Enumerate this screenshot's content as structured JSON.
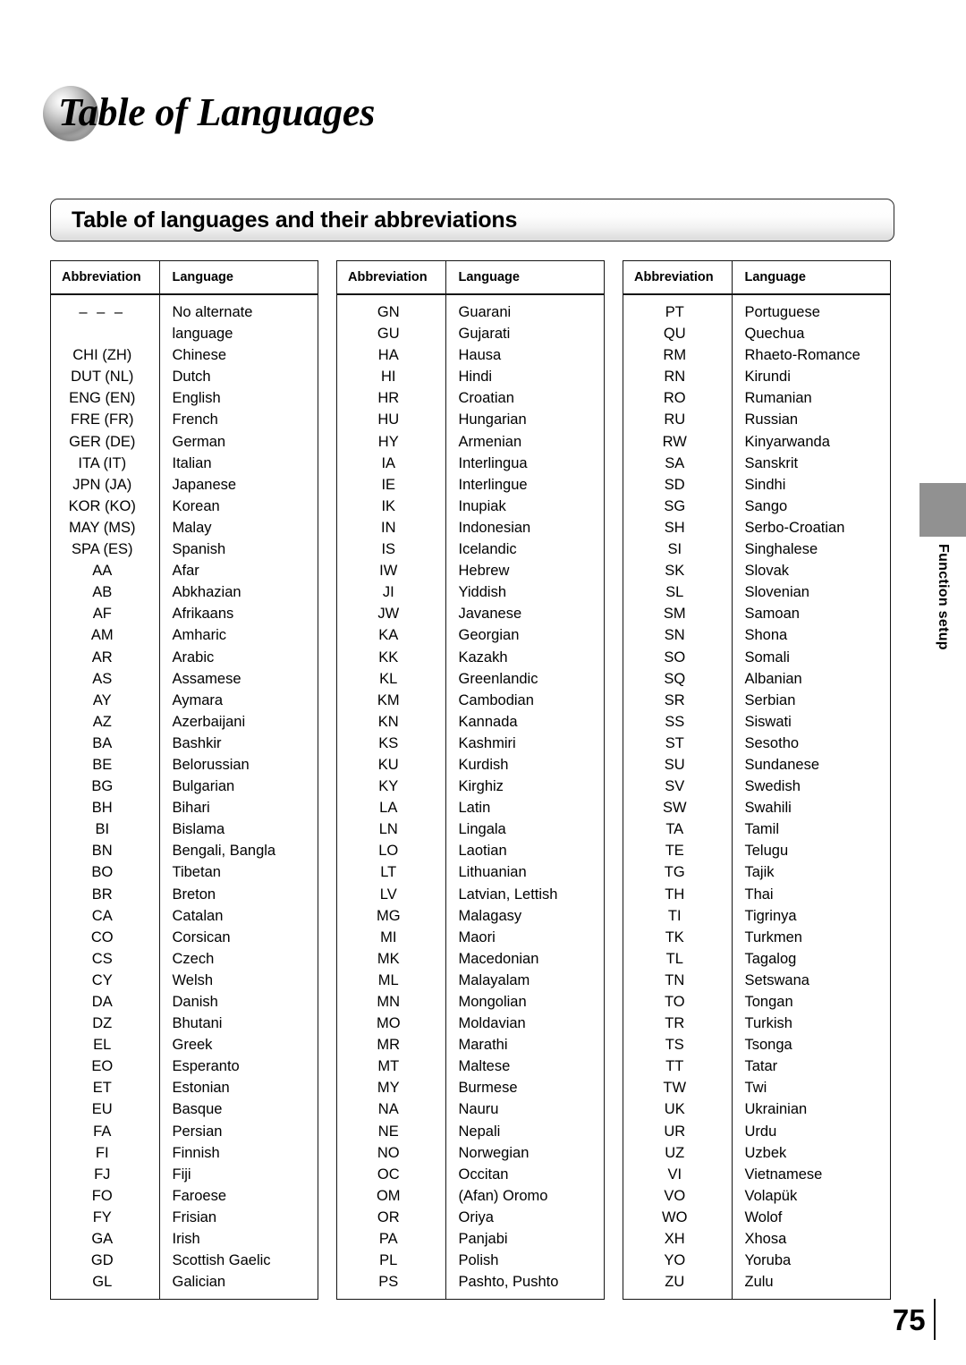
{
  "page": {
    "title": "Table of Languages",
    "section_heading": "Table of languages and their abbreviations",
    "number": "75",
    "side_tab_label": "Function setup"
  },
  "table_headers": {
    "abbreviation": "Abbreviation",
    "language": "Language"
  },
  "columns": [
    {
      "id": "column-1",
      "rows": [
        {
          "abbr": "– – –",
          "lang": "No alternate"
        },
        {
          "abbr": "",
          "lang": "language"
        },
        {
          "abbr": "CHI (ZH)",
          "lang": "Chinese"
        },
        {
          "abbr": "DUT (NL)",
          "lang": "Dutch"
        },
        {
          "abbr": "ENG (EN)",
          "lang": "English"
        },
        {
          "abbr": "FRE (FR)",
          "lang": "French"
        },
        {
          "abbr": "GER (DE)",
          "lang": "German"
        },
        {
          "abbr": "ITA (IT)",
          "lang": "Italian"
        },
        {
          "abbr": "JPN (JA)",
          "lang": "Japanese"
        },
        {
          "abbr": "KOR (KO)",
          "lang": "Korean"
        },
        {
          "abbr": "MAY (MS)",
          "lang": "Malay"
        },
        {
          "abbr": "SPA (ES)",
          "lang": "Spanish"
        },
        {
          "abbr": "AA",
          "lang": "Afar"
        },
        {
          "abbr": "AB",
          "lang": "Abkhazian"
        },
        {
          "abbr": "AF",
          "lang": "Afrikaans"
        },
        {
          "abbr": "AM",
          "lang": "Amharic"
        },
        {
          "abbr": "AR",
          "lang": "Arabic"
        },
        {
          "abbr": "AS",
          "lang": "Assamese"
        },
        {
          "abbr": "AY",
          "lang": "Aymara"
        },
        {
          "abbr": "AZ",
          "lang": "Azerbaijani"
        },
        {
          "abbr": "BA",
          "lang": "Bashkir"
        },
        {
          "abbr": "BE",
          "lang": "Belorussian"
        },
        {
          "abbr": "BG",
          "lang": "Bulgarian"
        },
        {
          "abbr": "BH",
          "lang": "Bihari"
        },
        {
          "abbr": "BI",
          "lang": "Bislama"
        },
        {
          "abbr": "BN",
          "lang": "Bengali, Bangla"
        },
        {
          "abbr": "BO",
          "lang": "Tibetan"
        },
        {
          "abbr": "BR",
          "lang": "Breton"
        },
        {
          "abbr": "CA",
          "lang": "Catalan"
        },
        {
          "abbr": "CO",
          "lang": "Corsican"
        },
        {
          "abbr": "CS",
          "lang": "Czech"
        },
        {
          "abbr": "CY",
          "lang": "Welsh"
        },
        {
          "abbr": "DA",
          "lang": "Danish"
        },
        {
          "abbr": "DZ",
          "lang": "Bhutani"
        },
        {
          "abbr": "EL",
          "lang": "Greek"
        },
        {
          "abbr": "EO",
          "lang": "Esperanto"
        },
        {
          "abbr": "ET",
          "lang": "Estonian"
        },
        {
          "abbr": "EU",
          "lang": "Basque"
        },
        {
          "abbr": "FA",
          "lang": "Persian"
        },
        {
          "abbr": "FI",
          "lang": "Finnish"
        },
        {
          "abbr": "FJ",
          "lang": "Fiji"
        },
        {
          "abbr": "FO",
          "lang": "Faroese"
        },
        {
          "abbr": "FY",
          "lang": "Frisian"
        },
        {
          "abbr": "GA",
          "lang": "Irish"
        },
        {
          "abbr": "GD",
          "lang": "Scottish Gaelic"
        },
        {
          "abbr": "GL",
          "lang": "Galician"
        }
      ]
    },
    {
      "id": "column-2",
      "rows": [
        {
          "abbr": "GN",
          "lang": "Guarani"
        },
        {
          "abbr": "GU",
          "lang": "Gujarati"
        },
        {
          "abbr": "HA",
          "lang": "Hausa"
        },
        {
          "abbr": "HI",
          "lang": "Hindi"
        },
        {
          "abbr": "HR",
          "lang": "Croatian"
        },
        {
          "abbr": "HU",
          "lang": "Hungarian"
        },
        {
          "abbr": "HY",
          "lang": "Armenian"
        },
        {
          "abbr": "IA",
          "lang": "Interlingua"
        },
        {
          "abbr": "IE",
          "lang": "Interlingue"
        },
        {
          "abbr": "IK",
          "lang": "Inupiak"
        },
        {
          "abbr": "IN",
          "lang": "Indonesian"
        },
        {
          "abbr": "IS",
          "lang": "Icelandic"
        },
        {
          "abbr": "IW",
          "lang": "Hebrew"
        },
        {
          "abbr": "JI",
          "lang": "Yiddish"
        },
        {
          "abbr": "JW",
          "lang": "Javanese"
        },
        {
          "abbr": "KA",
          "lang": "Georgian"
        },
        {
          "abbr": "KK",
          "lang": "Kazakh"
        },
        {
          "abbr": "KL",
          "lang": "Greenlandic"
        },
        {
          "abbr": "KM",
          "lang": "Cambodian"
        },
        {
          "abbr": "KN",
          "lang": "Kannada"
        },
        {
          "abbr": "KS",
          "lang": "Kashmiri"
        },
        {
          "abbr": "KU",
          "lang": "Kurdish"
        },
        {
          "abbr": "KY",
          "lang": "Kirghiz"
        },
        {
          "abbr": "LA",
          "lang": "Latin"
        },
        {
          "abbr": "LN",
          "lang": "Lingala"
        },
        {
          "abbr": "LO",
          "lang": "Laotian"
        },
        {
          "abbr": "LT",
          "lang": "Lithuanian"
        },
        {
          "abbr": "LV",
          "lang": "Latvian, Lettish"
        },
        {
          "abbr": "MG",
          "lang": "Malagasy"
        },
        {
          "abbr": "MI",
          "lang": "Maori"
        },
        {
          "abbr": "MK",
          "lang": "Macedonian"
        },
        {
          "abbr": "ML",
          "lang": "Malayalam"
        },
        {
          "abbr": "MN",
          "lang": "Mongolian"
        },
        {
          "abbr": "MO",
          "lang": "Moldavian"
        },
        {
          "abbr": "MR",
          "lang": "Marathi"
        },
        {
          "abbr": "MT",
          "lang": "Maltese"
        },
        {
          "abbr": "MY",
          "lang": "Burmese"
        },
        {
          "abbr": "NA",
          "lang": "Nauru"
        },
        {
          "abbr": "NE",
          "lang": "Nepali"
        },
        {
          "abbr": "NO",
          "lang": "Norwegian"
        },
        {
          "abbr": "OC",
          "lang": "Occitan"
        },
        {
          "abbr": "OM",
          "lang": "(Afan) Oromo"
        },
        {
          "abbr": "OR",
          "lang": "Oriya"
        },
        {
          "abbr": "PA",
          "lang": "Panjabi"
        },
        {
          "abbr": "PL",
          "lang": "Polish"
        },
        {
          "abbr": "PS",
          "lang": "Pashto, Pushto"
        }
      ]
    },
    {
      "id": "column-3",
      "rows": [
        {
          "abbr": "PT",
          "lang": "Portuguese"
        },
        {
          "abbr": "QU",
          "lang": "Quechua"
        },
        {
          "abbr": "RM",
          "lang": "Rhaeto-Romance"
        },
        {
          "abbr": "RN",
          "lang": "Kirundi"
        },
        {
          "abbr": "RO",
          "lang": "Rumanian"
        },
        {
          "abbr": "RU",
          "lang": "Russian"
        },
        {
          "abbr": "RW",
          "lang": "Kinyarwanda"
        },
        {
          "abbr": "SA",
          "lang": "Sanskrit"
        },
        {
          "abbr": "SD",
          "lang": "Sindhi"
        },
        {
          "abbr": "SG",
          "lang": "Sango"
        },
        {
          "abbr": "SH",
          "lang": "Serbo-Croatian"
        },
        {
          "abbr": "SI",
          "lang": "Singhalese"
        },
        {
          "abbr": "SK",
          "lang": "Slovak"
        },
        {
          "abbr": "SL",
          "lang": "Slovenian"
        },
        {
          "abbr": "SM",
          "lang": "Samoan"
        },
        {
          "abbr": "SN",
          "lang": "Shona"
        },
        {
          "abbr": "SO",
          "lang": "Somali"
        },
        {
          "abbr": "SQ",
          "lang": "Albanian"
        },
        {
          "abbr": "SR",
          "lang": "Serbian"
        },
        {
          "abbr": "SS",
          "lang": "Siswati"
        },
        {
          "abbr": "ST",
          "lang": "Sesotho"
        },
        {
          "abbr": "SU",
          "lang": "Sundanese"
        },
        {
          "abbr": "SV",
          "lang": "Swedish"
        },
        {
          "abbr": "SW",
          "lang": "Swahili"
        },
        {
          "abbr": "TA",
          "lang": "Tamil"
        },
        {
          "abbr": "TE",
          "lang": "Telugu"
        },
        {
          "abbr": "TG",
          "lang": "Tajik"
        },
        {
          "abbr": "TH",
          "lang": "Thai"
        },
        {
          "abbr": "TI",
          "lang": "Tigrinya"
        },
        {
          "abbr": "TK",
          "lang": "Turkmen"
        },
        {
          "abbr": "TL",
          "lang": "Tagalog"
        },
        {
          "abbr": "TN",
          "lang": "Setswana"
        },
        {
          "abbr": "TO",
          "lang": "Tongan"
        },
        {
          "abbr": "TR",
          "lang": "Turkish"
        },
        {
          "abbr": "TS",
          "lang": "Tsonga"
        },
        {
          "abbr": "TT",
          "lang": "Tatar"
        },
        {
          "abbr": "TW",
          "lang": "Twi"
        },
        {
          "abbr": "UK",
          "lang": "Ukrainian"
        },
        {
          "abbr": "UR",
          "lang": "Urdu"
        },
        {
          "abbr": "UZ",
          "lang": "Uzbek"
        },
        {
          "abbr": "VI",
          "lang": "Vietnamese"
        },
        {
          "abbr": "VO",
          "lang": "Volapük"
        },
        {
          "abbr": "WO",
          "lang": "Wolof"
        },
        {
          "abbr": "XH",
          "lang": "Xhosa"
        },
        {
          "abbr": "YO",
          "lang": "Yoruba"
        },
        {
          "abbr": "ZU",
          "lang": "Zulu"
        }
      ]
    }
  ]
}
